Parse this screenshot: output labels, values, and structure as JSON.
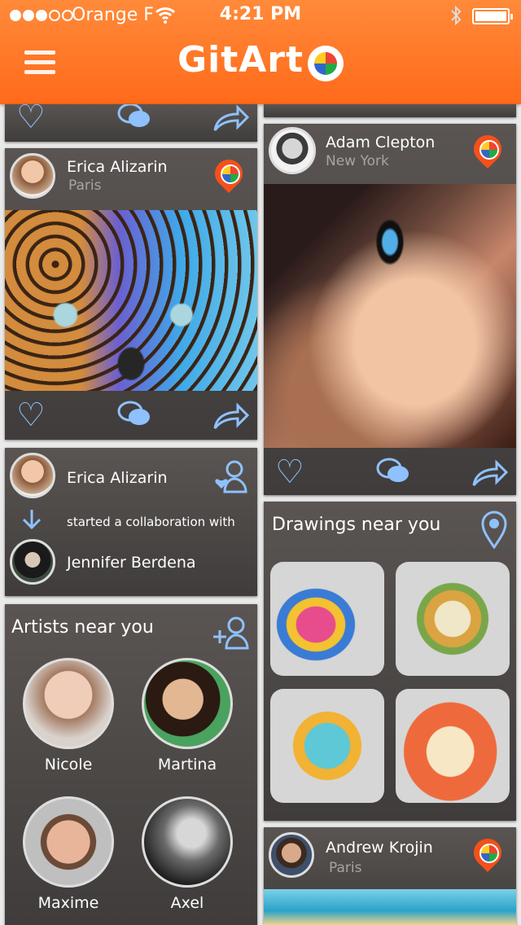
{
  "status": {
    "carrier": "Orange F",
    "time": "4:21 PM"
  },
  "header": {
    "title": "GitArt"
  },
  "posts": [
    {
      "name": "Erica Alizarin",
      "city": "Paris"
    },
    {
      "name": "Adam Clepton",
      "city": "New York"
    },
    {
      "name": "Andrew Krojin",
      "city": "Paris"
    }
  ],
  "activity": {
    "actor": "Erica Alizarin",
    "text": "started a collaboration with",
    "target": "Jennifer Berdena"
  },
  "artists": {
    "title": "Artists near you",
    "items": [
      {
        "name": "Nicole"
      },
      {
        "name": "Martina"
      },
      {
        "name": "Maxime"
      },
      {
        "name": "Axel"
      }
    ]
  },
  "drawings": {
    "title": "Drawings near you"
  },
  "colors": {
    "brand": "#ff7a2a",
    "accent": "#8fc1ff",
    "card": "#4c4846"
  },
  "icons": [
    "menu-icon",
    "heart-icon",
    "comment-icon",
    "share-icon",
    "location-pin-icon",
    "add-user-icon",
    "arrow-down-icon"
  ]
}
